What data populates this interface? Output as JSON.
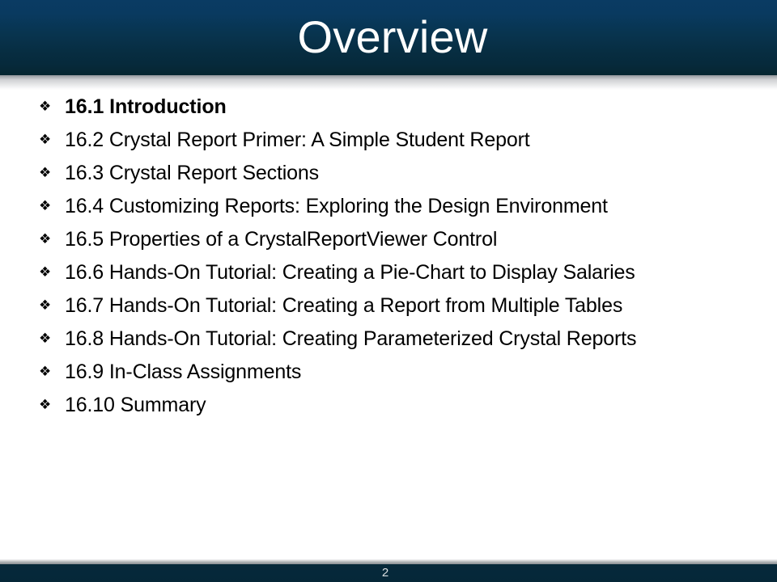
{
  "slide": {
    "title": "Overview",
    "page_number": "2",
    "colors": {
      "header_top": "#0a3b63",
      "header_bottom": "#05262f",
      "footer": "#052738",
      "title_text": "#ffffff",
      "body_text": "#000000",
      "page_number_text": "#d8dde0"
    },
    "bullet_glyph": "❖",
    "bullets": [
      {
        "text": "16.1 Introduction",
        "bold": true
      },
      {
        "text": "16.2 Crystal Report Primer: A Simple Student Report",
        "bold": false
      },
      {
        "text": "16.3 Crystal Report Sections",
        "bold": false
      },
      {
        "text": "16.4 Customizing Reports: Exploring the Design Environment",
        "bold": false
      },
      {
        "text": "16.5 Properties of a CrystalReportViewer Control",
        "bold": false
      },
      {
        "text": "16.6 Hands-On Tutorial: Creating a Pie-Chart to Display Salaries",
        "bold": false
      },
      {
        "text": "16.7 Hands-On Tutorial: Creating a Report from Multiple Tables",
        "bold": false
      },
      {
        "text": "16.8 Hands-On Tutorial: Creating Parameterized Crystal Reports",
        "bold": false
      },
      {
        "text": "16.9 In-Class Assignments",
        "bold": false
      },
      {
        "text": "16.10 Summary",
        "bold": false
      }
    ]
  }
}
